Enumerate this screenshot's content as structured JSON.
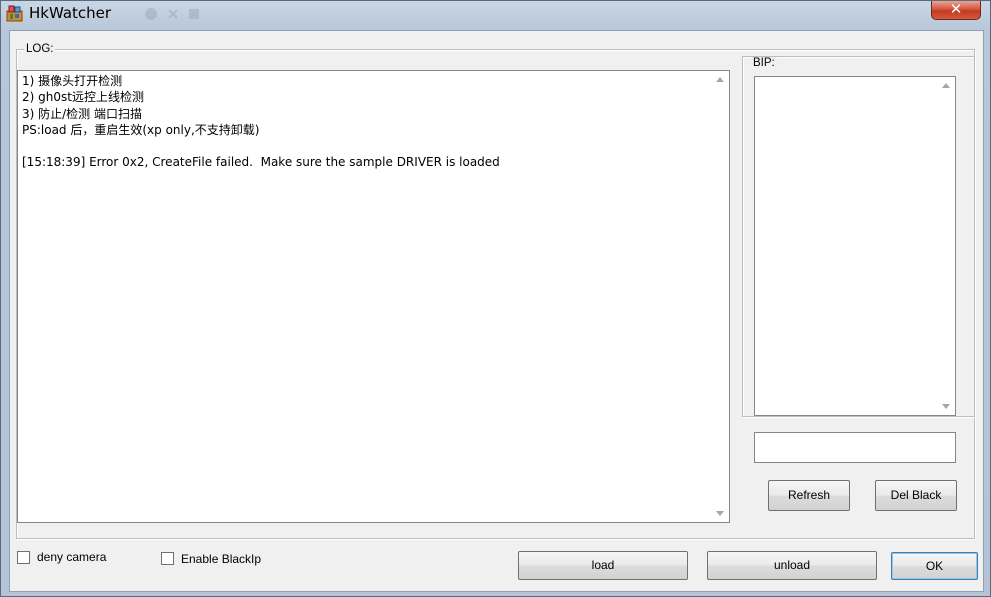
{
  "window": {
    "title": "HkWatcher",
    "close_glyph": "✕"
  },
  "log": {
    "label": "LOG:",
    "lines": [
      "1) 摄像头打开检测",
      "2) gh0st远控上线检测",
      "3) 防止/检测 端口扫描",
      "PS:load 后，重启生效(xp only,不支持卸载)",
      "",
      "[15:18:39] Error 0x2, CreateFile failed.  Make sure the sample DRIVER is loaded"
    ]
  },
  "bip": {
    "label": "BIP:",
    "input_value": ""
  },
  "buttons": {
    "refresh": "Refresh",
    "del_black": "Del Black",
    "load": "load",
    "unload": "unload",
    "ok": "OK"
  },
  "checkboxes": {
    "deny_camera": {
      "label": "deny camera",
      "checked": false
    },
    "enable_blackip": {
      "label": "Enable BlackIp",
      "checked": false
    }
  },
  "colors": {
    "close_button": "#c9452c",
    "client_bg": "#f0f0f0"
  }
}
